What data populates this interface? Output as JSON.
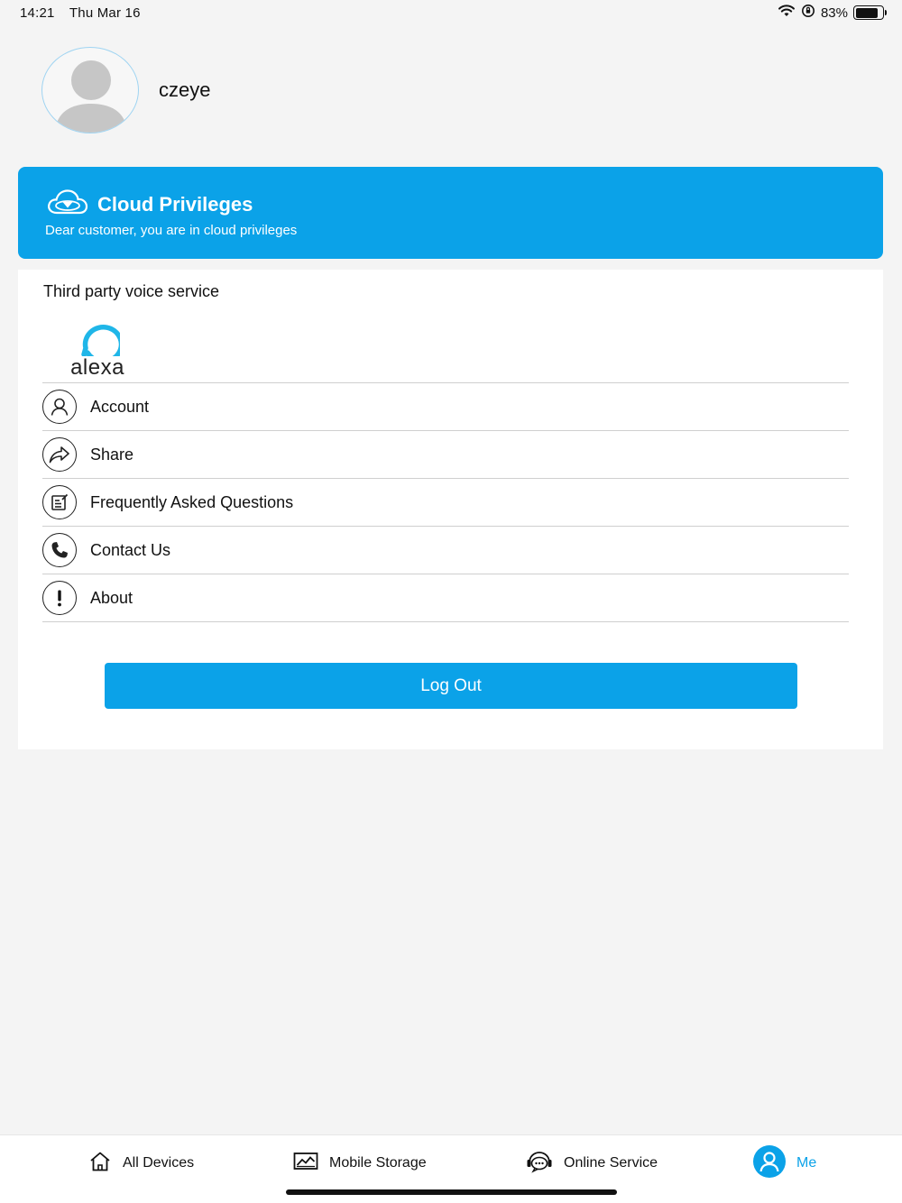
{
  "status_bar": {
    "time": "14:21",
    "date": "Thu Mar 16",
    "battery": "83%",
    "battery_level": 0.83
  },
  "profile": {
    "username": "czeye"
  },
  "cloud_banner": {
    "title": "Cloud Privileges",
    "subtitle": "Dear customer, you are in cloud privileges",
    "color": "#0ba2e8"
  },
  "voice_service": {
    "title": "Third party voice service",
    "alexa_label": "alexa"
  },
  "menu": {
    "items": [
      {
        "label": "Account",
        "icon": "user-icon"
      },
      {
        "label": "Share",
        "icon": "share-icon"
      },
      {
        "label": "Frequently Asked Questions",
        "icon": "faq-icon"
      },
      {
        "label": "Contact Us",
        "icon": "phone-icon"
      },
      {
        "label": "About",
        "icon": "info-icon"
      }
    ]
  },
  "logout_label": "Log Out",
  "tabbar": {
    "tabs": [
      {
        "label": "All Devices",
        "icon": "home-icon"
      },
      {
        "label": "Mobile Storage",
        "icon": "image-icon"
      },
      {
        "label": "Online Service",
        "icon": "chat-icon"
      },
      {
        "label": "Me",
        "icon": "person-icon",
        "active": true
      }
    ],
    "active_color": "#0ba2e8"
  }
}
